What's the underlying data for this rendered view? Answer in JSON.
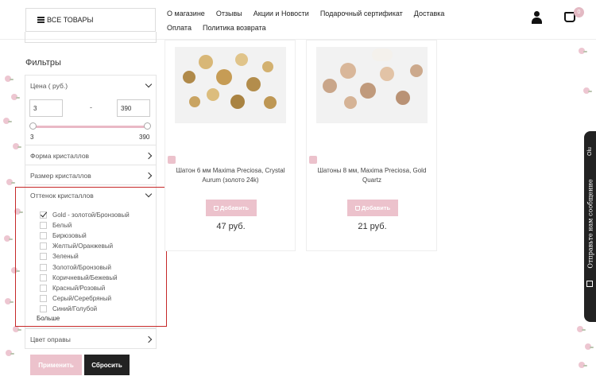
{
  "header": {
    "all_goods_label": "ВСЕ ТОВАРЫ",
    "nav_row1": [
      "О магазине",
      "Отзывы",
      "Акции и Новости",
      "Подарочный сертификат",
      "Доставка"
    ],
    "nav_row2": [
      "Оплата",
      "Политика возврата"
    ],
    "cart_count": "0"
  },
  "sidebar": {
    "filters_title": "Фильтры",
    "price": {
      "label": "Цена ( руб.)",
      "min_value": "3",
      "max_value": "390",
      "range_min_label": "3",
      "range_max_label": "390",
      "separator": "-"
    },
    "sections": {
      "crystal_shape": "Форма кристаллов",
      "crystal_size": "Размер кристаллов",
      "crystal_shade": "Оттенок кристаллов",
      "frame_color": "Цвет оправы"
    },
    "shade_options": [
      {
        "label": "Gold - золотой/Бронзовый",
        "checked": true
      },
      {
        "label": "Белый",
        "checked": false
      },
      {
        "label": "Бирюзовый",
        "checked": false
      },
      {
        "label": "Желтый/Оранжевый",
        "checked": false
      },
      {
        "label": "Зеленый",
        "checked": false
      },
      {
        "label": "Золотой/Бронзовый",
        "checked": false
      },
      {
        "label": "Коричневый/Бежевый",
        "checked": false
      },
      {
        "label": "Красный/Розовый",
        "checked": false
      },
      {
        "label": "Серый/Серебряный",
        "checked": false
      },
      {
        "label": "Синий/Голубой",
        "checked": false
      }
    ],
    "more_label": "Больше",
    "apply_label": "Применить",
    "reset_label": "Сбросить"
  },
  "products": [
    {
      "title": "Шатон 6 мм Maxima Preciosa, Crystal Aurum (золото 24k)",
      "button": "Добавить",
      "price": "47 руб."
    },
    {
      "title": "Шатоны 8 мм, Maxima Preciosa, Gold Quartz",
      "button": "Добавить",
      "price": "21 руб."
    }
  ],
  "feedback_widget": {
    "label": "Отправьте нам сообщение",
    "top_label": "Olu"
  },
  "colors": {
    "accent_pink": "#ecc2cc",
    "dark": "#222222",
    "highlight_red": "#c62828"
  }
}
